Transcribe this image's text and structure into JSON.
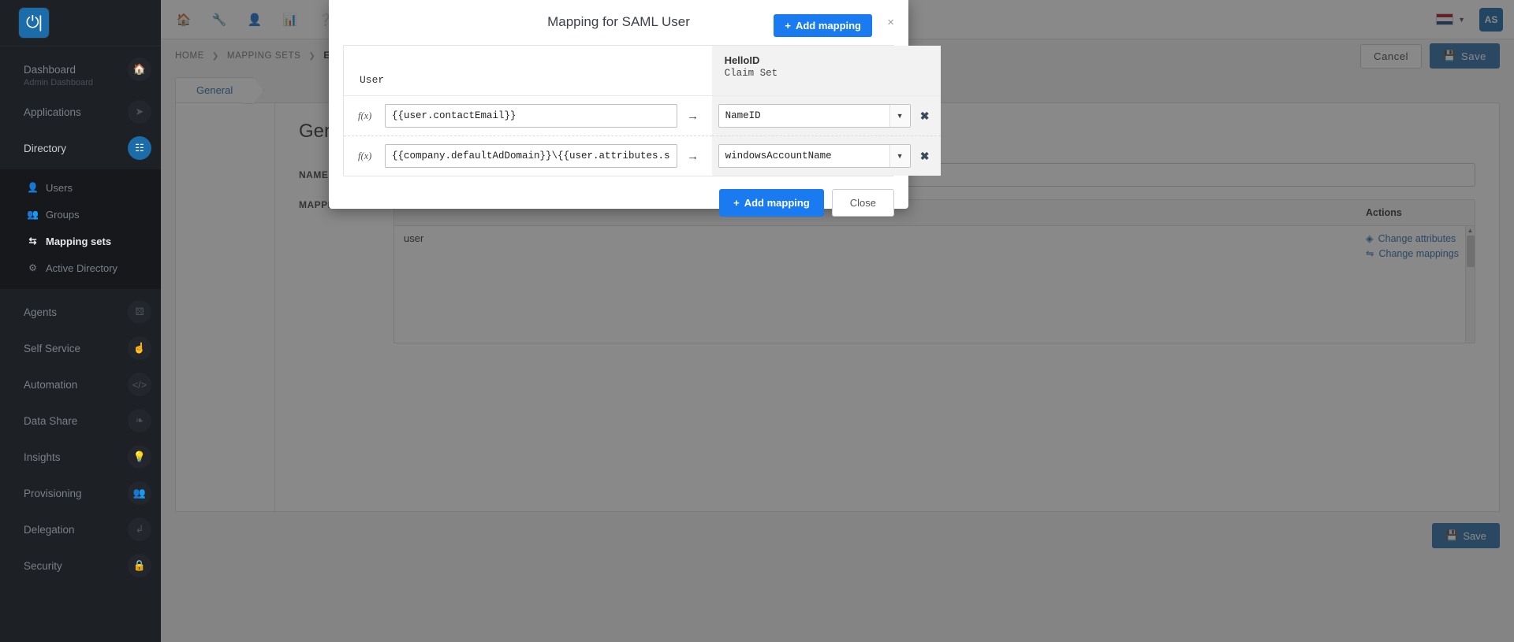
{
  "brand": {
    "logo_glyph": "⏻",
    "accent": "#1b6ca8",
    "blue": "#1a7bf0"
  },
  "sidebar": {
    "groups": [
      {
        "label": "Dashboard",
        "sublabel": "Admin Dashboard",
        "icon": "home-icon",
        "caret": "",
        "active": false
      },
      {
        "label": "Applications",
        "sublabel": "",
        "icon": "rocket-icon",
        "caret": "‹",
        "active": false
      },
      {
        "label": "Directory",
        "sublabel": "",
        "icon": "sitemap-icon",
        "caret": "∨",
        "active": true
      }
    ],
    "sub_items": [
      {
        "label": "Users",
        "icon": "user-icon",
        "active": false
      },
      {
        "label": "Groups",
        "icon": "users-icon",
        "active": false
      },
      {
        "label": "Mapping sets",
        "icon": "exchange-icon",
        "active": true
      },
      {
        "label": "Active Directory",
        "icon": "gear-icon",
        "active": false
      }
    ],
    "lower_items": [
      {
        "label": "Agents",
        "icon": "agents-icon",
        "caret": ""
      },
      {
        "label": "Self Service",
        "icon": "hand-icon",
        "caret": "‹"
      },
      {
        "label": "Automation",
        "icon": "code-icon",
        "caret": "‹"
      },
      {
        "label": "Data Share",
        "icon": "share-icon",
        "caret": ""
      },
      {
        "label": "Insights",
        "icon": "bulb-icon",
        "caret": "‹"
      },
      {
        "label": "Provisioning",
        "icon": "users-group-icon",
        "caret": "‹"
      },
      {
        "label": "Delegation",
        "icon": "arrow-turn-icon",
        "caret": "‹"
      },
      {
        "label": "Security",
        "icon": "lock-icon",
        "caret": "‹"
      }
    ]
  },
  "topbar": {
    "icons": [
      "home-icon",
      "wrench-icon",
      "user-icon",
      "chart-icon",
      "help-icon"
    ],
    "language": "NL",
    "avatar_initials": "AS"
  },
  "breadcrumb": {
    "items": [
      "HOME",
      "MAPPING SETS",
      "EDIT MA"
    ],
    "separator": "❯"
  },
  "page": {
    "cancel_label": "Cancel",
    "save_label": "Save",
    "save_icon": "ὋE",
    "tab_label": "General",
    "heading": "Gen",
    "name_label": "NAME",
    "mapping_label": "MAPPI",
    "table": {
      "columns": [
        "",
        "",
        "Actions"
      ],
      "actions_header": "Actions",
      "row_text": "user",
      "actions": [
        {
          "label": "Change attributes",
          "icon": "diamond-icon"
        },
        {
          "label": "Change mappings",
          "icon": "shuffle-icon"
        }
      ]
    },
    "bottom_save_label": "Save"
  },
  "modal": {
    "title": "Mapping for SAML User",
    "header_add_label": "Add mapping",
    "header_add_icon": "+",
    "close_icon": "×",
    "left_column_header": "User",
    "right_column_header_title": "HelloID",
    "right_column_header_sub": "Claim Set",
    "fx_label": "f(x)",
    "arrow": "→",
    "remove_icon": "✖",
    "caret_icon": "▼",
    "rows": [
      {
        "expression": "{{user.contactEmail}}",
        "claim": "NameID"
      },
      {
        "expression": "{{company.defaultAdDomain}}\\{{user.attributes.s",
        "claim": "windowsAccountName"
      }
    ],
    "footer": {
      "add_label": "Add mapping",
      "add_icon": "+",
      "close_label": "Close"
    }
  }
}
